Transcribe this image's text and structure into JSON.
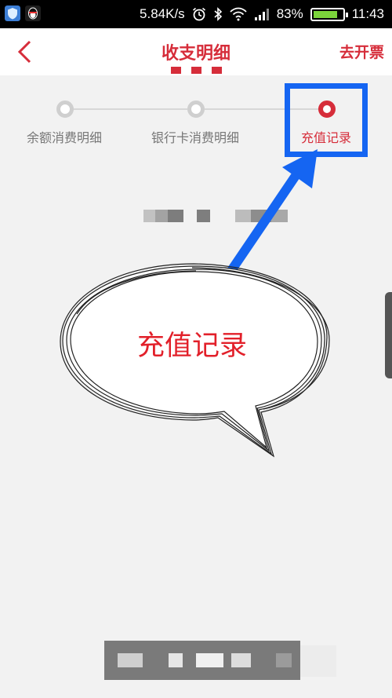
{
  "status_bar": {
    "network_speed": "5.84K/s",
    "battery_percent": "83%",
    "battery_level": 0.83,
    "time": "11:43",
    "left_icons": [
      "shield-app-icon",
      "qq-penguin-icon"
    ],
    "right_icons": [
      "alarm-icon",
      "bluetooth-icon",
      "wifi-icon",
      "signal-icon"
    ]
  },
  "header": {
    "title": "收支明细",
    "action_label": "去开票",
    "back_icon": "chevron-left-icon"
  },
  "steps": [
    {
      "label": "余额消费明细",
      "active": false
    },
    {
      "label": "银行卡消费明细",
      "active": false
    },
    {
      "label": "充值记录",
      "active": true
    }
  ],
  "annotation": {
    "bubble_text": "充值记录",
    "highlight_color": "#1565f2"
  },
  "colors": {
    "accent": "#d62d3a",
    "annotation_blue": "#1565f2",
    "bubble_text": "#e2202a",
    "inactive_step": "#cfcfcf"
  }
}
